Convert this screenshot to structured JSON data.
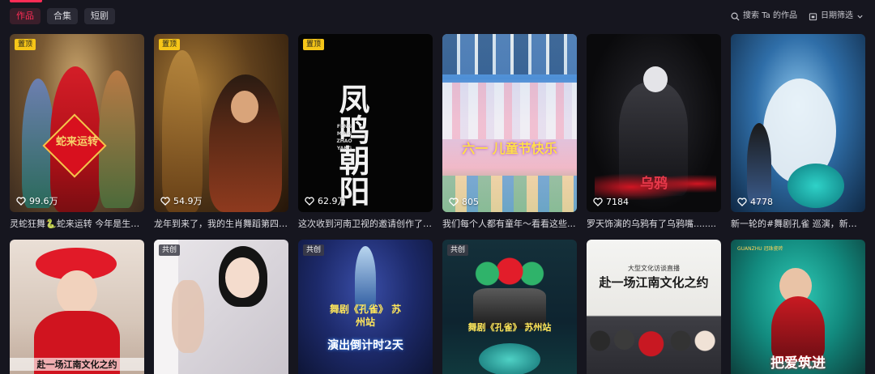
{
  "tabs": [
    {
      "label": "作品",
      "active": true
    },
    {
      "label": "合集",
      "active": false
    },
    {
      "label": "短剧",
      "active": false
    }
  ],
  "tools": {
    "search_label": "搜索 Ta 的作品",
    "date_filter_label": "日期筛选"
  },
  "row1": [
    {
      "badge": "置顶",
      "likes": "99.6万",
      "caption": "灵蛇狂舞🐍蛇来运转 今年是生肖...",
      "art_text": "蛇来运转"
    },
    {
      "badge": "置顶",
      "likes": "54.9万",
      "caption": "龙年到来了，我的生肖舞蹈第四部..."
    },
    {
      "badge": "置顶",
      "likes": "62.9万",
      "caption": "这次收到河南卫视的邀请创作了这...",
      "art_text": "凤鸣朝阳",
      "art_sub": "FENG MING ZHAO YANG"
    },
    {
      "likes": "805",
      "caption": "我们每个人都有童年～看看这些...",
      "art_text": "六一 儿童节快乐"
    },
    {
      "likes": "7184",
      "caption": "罗天饰演的乌鸦有了乌鸦嘴........",
      "art_text": "乌鸦"
    },
    {
      "likes": "4778",
      "caption": "新一轮的#舞剧孔雀 巡演，新的舞..."
    }
  ],
  "row2": [
    {
      "art_text": "赴一场江南文化之约"
    },
    {
      "badge": "共创"
    },
    {
      "badge": "共创",
      "art_text": "舞剧《孔雀》 苏州站",
      "art_sub": "演出倒计时2天"
    },
    {
      "badge": "共创",
      "art_text": "舞剧《孔雀》 苏州站"
    },
    {
      "art_text": "赴一场江南文化之约",
      "art_sub": "大型文化访谈直播"
    },
    {
      "art_text": "把爱筑进",
      "art_sub": "GUANZHU 冠珠瓷砖"
    }
  ],
  "colors": {
    "accent": "#fe2c55",
    "badge_top": "#f5c518",
    "background": "#16161f"
  }
}
